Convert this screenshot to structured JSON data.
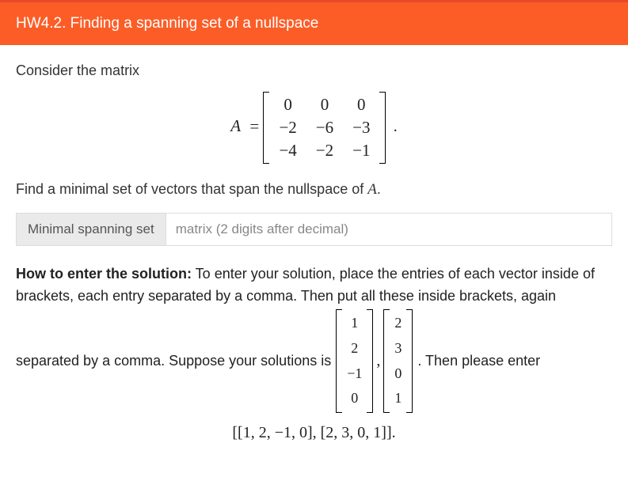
{
  "title": "HW4.2. Finding a spanning set of a nullspace",
  "prompt": "Consider the matrix",
  "matrix_var": "A",
  "equals": "=",
  "matrix_rows": [
    [
      "0",
      "0",
      "0"
    ],
    [
      "−2",
      "−6",
      "−3"
    ],
    [
      "−4",
      "−2",
      "−1"
    ]
  ],
  "matrix_period": ".",
  "question_pre": "Find a minimal set of vectors that span the nullspace of ",
  "question_var": "A",
  "question_post": ".",
  "answer_label": "Minimal spanning set",
  "answer_placeholder": "matrix (2 digits after decimal)",
  "instruction_bold": "How to enter the solution:",
  "instruction_p1": " To enter your solution, place the entries of each vector inside of brackets, each entry separated by a comma. Then put all these inside brackets, again",
  "instruction_p2a": "separated by a comma. Suppose your solutions is ",
  "instruction_p2b": ". Then please enter",
  "example_vec1": [
    "1",
    "2",
    "−1",
    "0"
  ],
  "example_vec2": [
    "2",
    "3",
    "0",
    "1"
  ],
  "final_entry": "[[1, 2, −1, 0], [2, 3, 0, 1]].",
  "chart_data": {
    "type": "table",
    "title": "Matrix A and example nullspace vectors",
    "matrix_A": [
      [
        0,
        0,
        0
      ],
      [
        -2,
        -6,
        -3
      ],
      [
        -4,
        -2,
        -1
      ]
    ],
    "example_vectors": [
      [
        1,
        2,
        -1,
        0
      ],
      [
        2,
        3,
        0,
        1
      ]
    ]
  }
}
